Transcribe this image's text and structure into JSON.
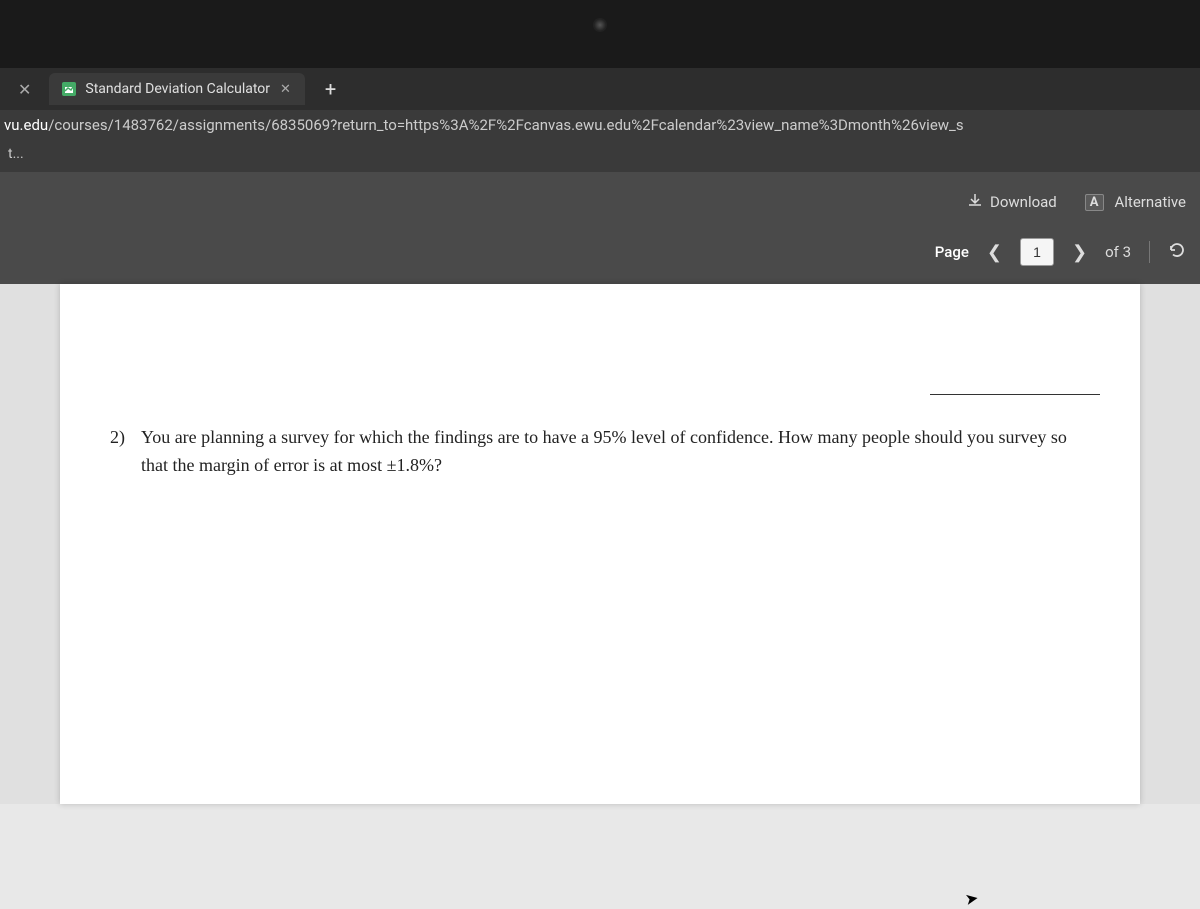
{
  "tabs": {
    "active": {
      "title": "Standard Deviation Calculator"
    }
  },
  "address": {
    "domain": "vu.edu",
    "path": "/courses/1483762/assignments/6835069?return_to=https%3A%2F%2Fcanvas.ewu.edu%2Fcalendar%23view_name%3Dmonth%26view_s"
  },
  "bookmarks": {
    "truncated": "t..."
  },
  "viewer": {
    "download_label": "Download",
    "alternative_label": "Alternative"
  },
  "pager": {
    "label": "Page",
    "current": "1",
    "of": "of 3"
  },
  "document": {
    "q2": {
      "num": "2)",
      "text": "You are planning a survey for which the findings are to have a 95% level of confidence. How many people should you survey so that the margin of error is at most ±1.8%?"
    }
  }
}
